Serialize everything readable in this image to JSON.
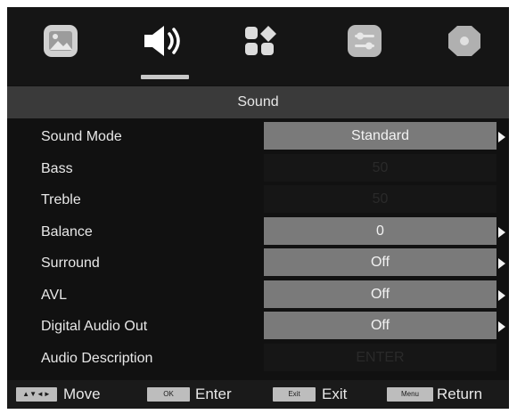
{
  "tabs": [
    {
      "icon": "picture-icon",
      "selected": false
    },
    {
      "icon": "speaker-icon",
      "selected": true
    },
    {
      "icon": "channels-icon",
      "selected": false
    },
    {
      "icon": "settings-icon",
      "selected": false
    },
    {
      "icon": "lock-icon",
      "selected": false
    }
  ],
  "menu": {
    "title": "Sound",
    "items": [
      {
        "label": "Sound Mode",
        "value": "Standard",
        "enabled": true,
        "has_arrow": true
      },
      {
        "label": "Bass",
        "value": "50",
        "enabled": false,
        "has_arrow": false
      },
      {
        "label": "Treble",
        "value": "50",
        "enabled": false,
        "has_arrow": false
      },
      {
        "label": "Balance",
        "value": "0",
        "enabled": true,
        "has_arrow": true
      },
      {
        "label": "Surround",
        "value": "Off",
        "enabled": true,
        "has_arrow": true
      },
      {
        "label": "AVL",
        "value": "Off",
        "enabled": true,
        "has_arrow": true
      },
      {
        "label": "Digital Audio Out",
        "value": "Off",
        "enabled": true,
        "has_arrow": true
      },
      {
        "label": "Audio Description",
        "value": "ENTER",
        "enabled": false,
        "has_arrow": false
      }
    ]
  },
  "footer": {
    "move_key": "▲▼◄►",
    "move_label": "Move",
    "ok_key": "OK",
    "enter_label": "Enter",
    "exit_key": "Exit",
    "exit_label": "Exit",
    "menu_key": "Menu",
    "return_label": "Return"
  },
  "colors": {
    "background": "#111111",
    "title_bar": "#3a3a3a",
    "value_box": "#7a7a7a",
    "disabled_box": "#161616",
    "text": "#e8e8e8"
  }
}
